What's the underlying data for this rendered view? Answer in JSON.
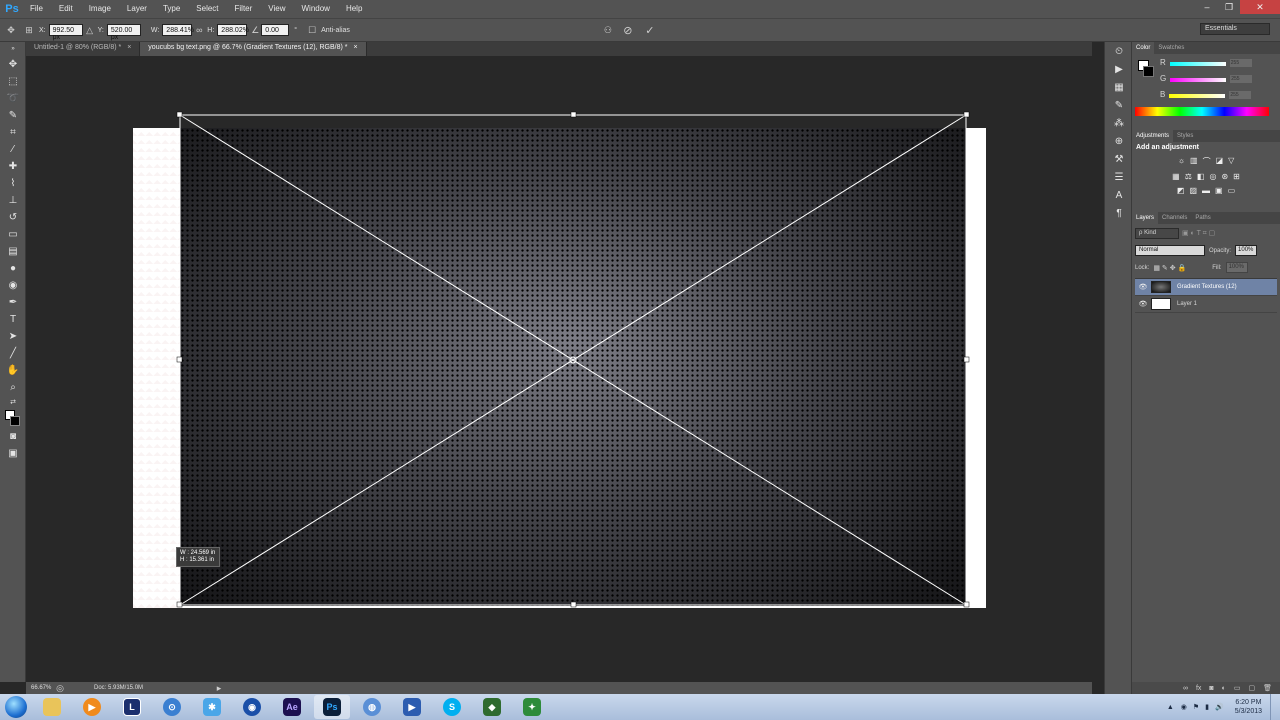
{
  "app": {
    "logo": "Ps"
  },
  "menu": [
    "File",
    "Edit",
    "Image",
    "Layer",
    "Type",
    "Select",
    "Filter",
    "View",
    "Window",
    "Help"
  ],
  "window_controls": {
    "minimize": "–",
    "restore": "❐",
    "close": "✕"
  },
  "options": {
    "x_label": "X:",
    "x_value": "992.50 px",
    "y_label": "Y:",
    "y_value": "520.00 px",
    "w_label": "W:",
    "w_value": "288.41%",
    "h_label": "H:",
    "h_value": "288.02%",
    "angle_value": "0.00",
    "angle_unit": "°",
    "antialias_label": "Anti-alias",
    "workspace": "Essentials"
  },
  "tabs": [
    {
      "label": "Untitled-1 @ 80% (RGB/8) *",
      "close": "×"
    },
    {
      "label": "youcubs bg text.png @ 66.7% (Gradient Textures (12), RGB/8) *",
      "close": "×"
    }
  ],
  "transform_readout": {
    "w": "W : 24.569 in",
    "h": "H : 15.361 in"
  },
  "status": {
    "zoom": "66.67%",
    "doc": "Doc: 5.93M/15.0M"
  },
  "color_panel": {
    "tabs": [
      "Color",
      "Swatches"
    ],
    "channels": [
      {
        "label": "R",
        "value": "255",
        "color": "#00ffff"
      },
      {
        "label": "G",
        "value": "255",
        "color": "#ff00ff"
      },
      {
        "label": "B",
        "value": "255",
        "color": "#ffff00"
      }
    ]
  },
  "adjust_panel": {
    "tabs": [
      "Adjustments",
      "Styles"
    ],
    "title": "Add an adjustment"
  },
  "layers_panel": {
    "tabs": [
      "Layers",
      "Channels",
      "Paths"
    ],
    "kind": "ρ Kind",
    "blend": "Normal",
    "opacity_label": "Opacity:",
    "opacity_value": "100%",
    "lock_label": "Lock:",
    "fill_label": "Fill:",
    "fill_value": "100%",
    "layers": [
      {
        "name": "Gradient Textures (12)",
        "selected": true
      },
      {
        "name": "Layer 1",
        "selected": false
      }
    ]
  },
  "tray": {
    "time": "6:20 PM",
    "date": "5/3/2013"
  },
  "colors": {
    "accent": "#31a8ff",
    "panel": "#535353",
    "canvas_bg": "#282828",
    "selection": "#6f83a6"
  }
}
